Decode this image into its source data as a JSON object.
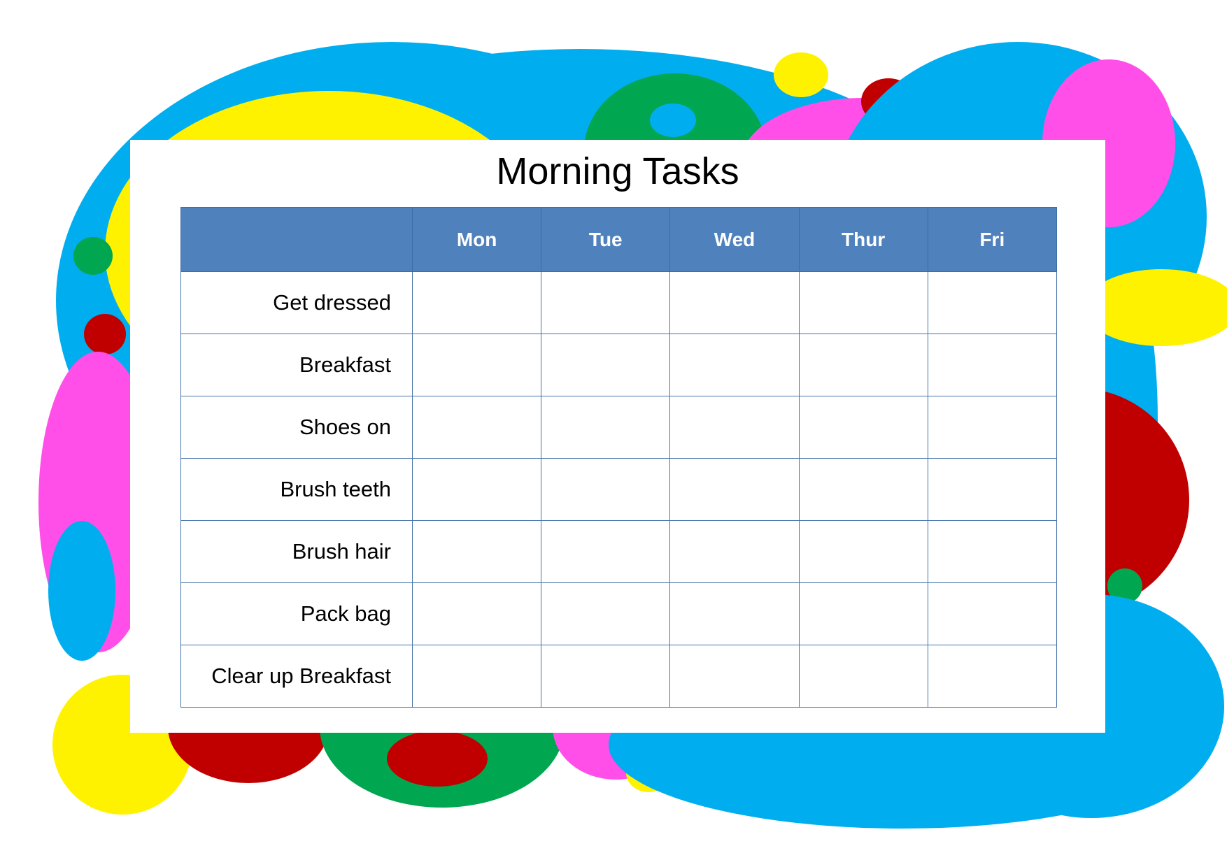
{
  "page": {
    "title": "Morning Tasks",
    "background_color": "#FFFFFF",
    "card_color": "#FFFFFF"
  },
  "colors": {
    "cyan": "#00AEEF",
    "yellow": "#FFF200",
    "green": "#00A650",
    "magenta": "#FF4FE8",
    "dark_red": "#C00000",
    "header_blue": "#4F81BD",
    "grid_blue": "#4472A8",
    "text_black": "#000000",
    "header_text": "#FFFFFF"
  },
  "table": {
    "corner_header": "",
    "day_headers": [
      "Mon",
      "Tue",
      "Wed",
      "Thur",
      "Fri"
    ],
    "rows": [
      {
        "task": "Get dressed",
        "cells": [
          "",
          "",
          "",
          "",
          ""
        ]
      },
      {
        "task": "Breakfast",
        "cells": [
          "",
          "",
          "",
          "",
          ""
        ]
      },
      {
        "task": "Shoes on",
        "cells": [
          "",
          "",
          "",
          "",
          ""
        ]
      },
      {
        "task": "Brush teeth",
        "cells": [
          "",
          "",
          "",
          "",
          ""
        ]
      },
      {
        "task": "Brush hair",
        "cells": [
          "",
          "",
          "",
          "",
          ""
        ]
      },
      {
        "task": "Pack bag",
        "cells": [
          "",
          "",
          "",
          "",
          ""
        ]
      },
      {
        "task": "Clear up Breakfast",
        "cells": [
          "",
          "",
          "",
          "",
          ""
        ]
      }
    ]
  },
  "decorations": {
    "description": "colourful overlapping ellipse confetti border",
    "shapes": [
      {
        "name": "cyan-ellipse-top-left",
        "color": "#00AEEF"
      },
      {
        "name": "yellow-ellipse-top-left",
        "color": "#FFF200"
      },
      {
        "name": "green-ellipse-top-center",
        "color": "#00A650"
      },
      {
        "name": "cyan-dot-in-green",
        "color": "#00AEEF"
      },
      {
        "name": "yellow-ellipse-top",
        "color": "#FFF200"
      },
      {
        "name": "dark-red-ellipse-top",
        "color": "#C00000"
      },
      {
        "name": "magenta-ellipse-top",
        "color": "#FF4FE8"
      },
      {
        "name": "cyan-ellipse-top-right",
        "color": "#00AEEF"
      },
      {
        "name": "magenta-ellipse-right",
        "color": "#FF4FE8"
      },
      {
        "name": "green-dot-left",
        "color": "#00A650"
      },
      {
        "name": "dark-red-dot-left",
        "color": "#C00000"
      },
      {
        "name": "magenta-ellipse-left",
        "color": "#FF4FE8"
      },
      {
        "name": "cyan-ellipse-left",
        "color": "#00AEEF"
      },
      {
        "name": "yellow-ellipse-right",
        "color": "#FFF200"
      },
      {
        "name": "dark-red-ellipse-right",
        "color": "#C00000"
      },
      {
        "name": "green-dot-in-red-right",
        "color": "#00A650"
      },
      {
        "name": "magenta-dot-right",
        "color": "#FF4FE8"
      },
      {
        "name": "yellow-circle-bottom-left",
        "color": "#FFF200"
      },
      {
        "name": "dark-red-ellipse-bottom",
        "color": "#C00000"
      },
      {
        "name": "green-ellipse-bottom",
        "color": "#00A650"
      },
      {
        "name": "dark-red-dot-in-green",
        "color": "#C00000"
      },
      {
        "name": "magenta-ellipse-bottom",
        "color": "#FF4FE8"
      },
      {
        "name": "yellow-dot-in-magenta",
        "color": "#FFF200"
      },
      {
        "name": "cyan-ellipse-bottom-right",
        "color": "#00AEEF"
      }
    ]
  }
}
